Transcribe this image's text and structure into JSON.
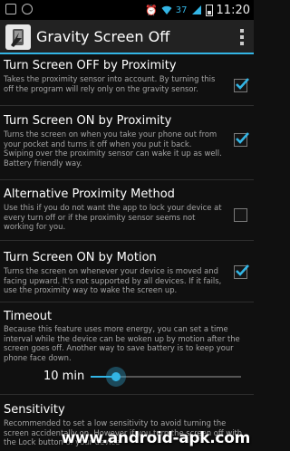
{
  "status_bar": {
    "battery_percent": "37",
    "time": "11:20"
  },
  "action_bar": {
    "title": "Gravity Screen Off",
    "overflow_icon": "overflow-menu-icon"
  },
  "preferences": [
    {
      "title": "Turn Screen OFF by Proximity",
      "summary": "Takes the proximity sensor into account. By turning this off the program will rely only on the gravity sensor.",
      "checked": true
    },
    {
      "title": "Turn Screen ON by Proximity",
      "summary": "Turns the screen on when you take your phone out from your pocket and turns it off when you put it back. Swiping over the proximity sensor can wake it up as well. Battery friendly way.",
      "checked": true
    },
    {
      "title": "Alternative Proximity Method",
      "summary": "Use this if you do not want the app to lock your device at every turn off or if the proximity sensor seems not working for you.",
      "checked": false
    },
    {
      "title": "Turn Screen ON by Motion",
      "summary": "Turns the screen on whenever your device is moved and facing upward. It's not supported by all devices. If it fails, use the proximity way to wake the screen up.",
      "checked": true
    },
    {
      "title": "Timeout",
      "summary": "Because this feature uses more energy, you can set a time interval while the device can be woken up by motion after the screen goes off. Another way to save battery is to keep your phone face down."
    },
    {
      "title": "Sensitivity",
      "summary": "Recommended to set a low sensitivity to avoid turning the screen accidentally on. However if you turn the screen off with the Lock button of your device"
    }
  ],
  "timeout_slider": {
    "value_label": "10 min",
    "level": 0.17
  },
  "watermark": "www.android-apk.com",
  "colors": {
    "accent": "#33b5e5",
    "background": "#101010",
    "action_bar": "#222222"
  }
}
